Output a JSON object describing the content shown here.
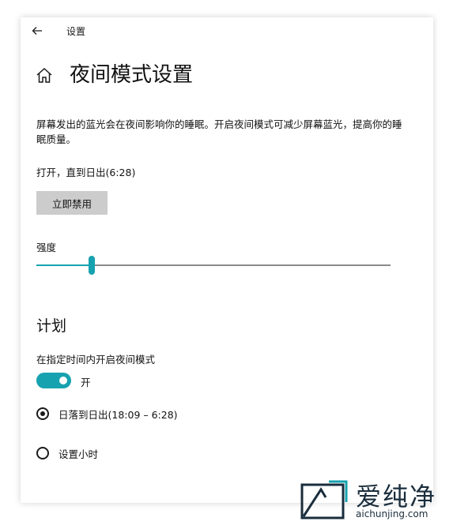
{
  "window": {
    "title": "设置"
  },
  "page": {
    "title": "夜间模式设置",
    "description": "屏幕发出的蓝光会在夜间影响你的睡眠。开启夜间模式可减少屏幕蓝光，提高你的睡眠质量。",
    "status": "打开，直到日出(6:28)",
    "disable_button": "立即禁用"
  },
  "strength": {
    "label": "强度",
    "value_fraction": 0.156
  },
  "schedule": {
    "heading": "计划",
    "label": "在指定时间内开启夜间模式",
    "toggle_state": "开",
    "toggle_on": true,
    "options": [
      {
        "label": "日落到日出(18:09 – 6:28)",
        "selected": true
      },
      {
        "label": "设置小时",
        "selected": false
      }
    ]
  },
  "watermark": {
    "name": "爱纯净",
    "url": "aichunjing.com"
  },
  "colors": {
    "accent": "#17a2b0",
    "button_bg": "#cccccc",
    "text": "#111111"
  },
  "icons": {
    "back": "back-arrow-icon",
    "home": "home-icon"
  }
}
